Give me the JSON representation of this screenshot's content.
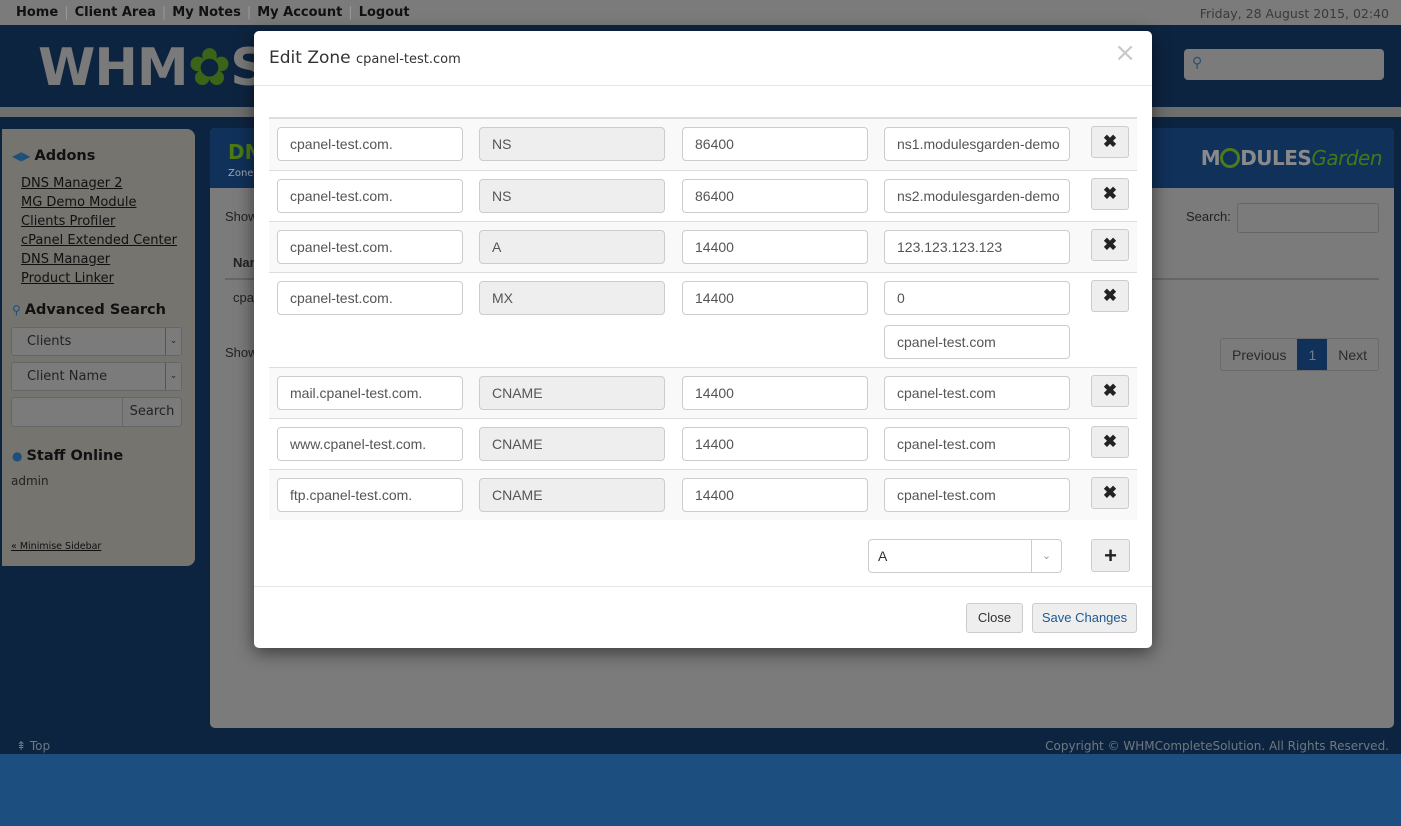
{
  "topbar": {
    "nav": [
      "Home",
      "Client Area",
      "My Notes",
      "My Account",
      "Logout"
    ],
    "date": "Friday, 28 August 2015, 02:40"
  },
  "header": {
    "logo_text_a": "WHM",
    "logo_text_gear": "✿",
    "logo_text_b": "S",
    "search_icon": "search-icon"
  },
  "sidebar": {
    "addons_title": "Addons",
    "addons": [
      "DNS Manager 2",
      "MG Demo Module",
      "Clients Profiler",
      "cPanel Extended Center",
      "DNS Manager",
      "Product Linker"
    ],
    "advanced_search_title": "Advanced Search",
    "search_type": "Clients",
    "search_field": "Client Name",
    "search_button": "Search",
    "staff_title": "Staff Online",
    "staff": "admin",
    "minimise": "« Minimise Sidebar"
  },
  "content": {
    "title": "DNS",
    "subtitle": "Zones",
    "show_top": "Show",
    "show_bottom": "Show",
    "col_name": "Nam",
    "row_name": "cpa",
    "search_label": "Search:",
    "brand_a": "M",
    "brand_b": "DULES",
    "brand_c": "Garden",
    "pager": {
      "previous": "Previous",
      "current": "1",
      "next": "Next"
    }
  },
  "footer": {
    "top": "⇞ Top",
    "copyright": "Copyright © WHMCompleteSolution. All Rights Reserved."
  },
  "modal": {
    "title": "Edit Zone",
    "domain": "cpanel-test.com",
    "close_icon": "×",
    "records": [
      {
        "name": "cpanel-test.com.",
        "type": "NS",
        "ttl": "86400",
        "values": [
          "ns1.modulesgarden-demo"
        ]
      },
      {
        "name": "cpanel-test.com.",
        "type": "NS",
        "ttl": "86400",
        "values": [
          "ns2.modulesgarden-demo"
        ]
      },
      {
        "name": "cpanel-test.com.",
        "type": "A",
        "ttl": "14400",
        "values": [
          "123.123.123.123"
        ]
      },
      {
        "name": "cpanel-test.com.",
        "type": "MX",
        "ttl": "14400",
        "values": [
          "0",
          "cpanel-test.com"
        ]
      },
      {
        "name": "mail.cpanel-test.com.",
        "type": "CNAME",
        "ttl": "14400",
        "values": [
          "cpanel-test.com"
        ]
      },
      {
        "name": "www.cpanel-test.com.",
        "type": "CNAME",
        "ttl": "14400",
        "values": [
          "cpanel-test.com"
        ]
      },
      {
        "name": "ftp.cpanel-test.com.",
        "type": "CNAME",
        "ttl": "14400",
        "values": [
          "cpanel-test.com"
        ]
      }
    ],
    "delete_icon": "✖",
    "new_record_type": "A",
    "add_icon": "+",
    "close_button": "Close",
    "save_button": "Save Changes"
  }
}
